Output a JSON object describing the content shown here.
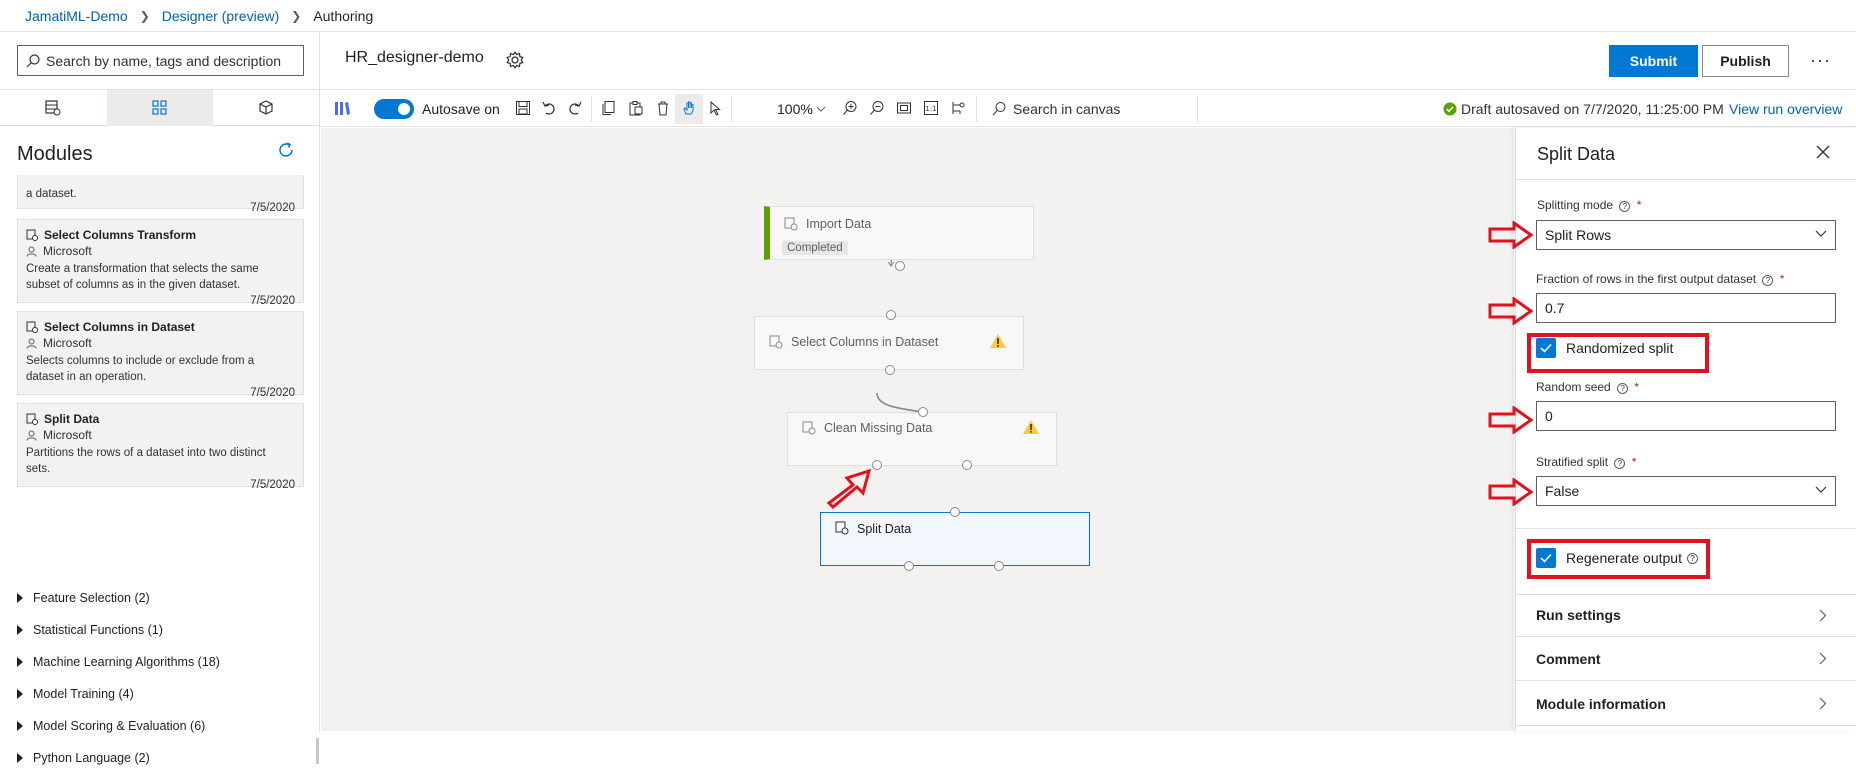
{
  "breadcrumb": {
    "workspace": "JamatiML-Demo",
    "designer": "Designer (preview)",
    "current": "Authoring"
  },
  "search": {
    "placeholder": "Search by name, tags and description"
  },
  "modules": {
    "title": "Modules",
    "cards": [
      {
        "name": "",
        "author": "",
        "desc": "a dataset.",
        "date": "7/5/2020"
      },
      {
        "name": "Select Columns Transform",
        "author": "Microsoft",
        "desc": "Create a transformation that selects the same subset of columns as in the given dataset.",
        "date": "7/5/2020"
      },
      {
        "name": "Select Columns in Dataset",
        "author": "Microsoft",
        "desc": "Selects columns to include or exclude from a dataset in an operation.",
        "date": "7/5/2020"
      },
      {
        "name": "Split Data",
        "author": "Microsoft",
        "desc": "Partitions the rows of a dataset into two distinct sets.",
        "date": "7/5/2020"
      }
    ],
    "categories": [
      "Feature Selection (2)",
      "Statistical Functions (1)",
      "Machine Learning Algorithms (18)",
      "Model Training (4)",
      "Model Scoring & Evaluation (6)",
      "Python Language (2)"
    ]
  },
  "header": {
    "pipeline_name": "HR_designer-demo",
    "submit": "Submit",
    "publish": "Publish",
    "more": "···"
  },
  "toolbar": {
    "autosave": "Autosave on",
    "zoom": "100%",
    "canvas_search": "Search in canvas",
    "draft_status": "Draft autosaved on 7/7/2020, 11:25:00 PM",
    "view_run": "View run overview"
  },
  "canvas": {
    "nodes": [
      {
        "title": "Import Data",
        "status": "Completed"
      },
      {
        "title": "Select Columns in Dataset"
      },
      {
        "title": "Clean Missing Data"
      },
      {
        "title": "Split Data"
      }
    ]
  },
  "panel": {
    "title": "Split Data",
    "splitting_mode_label": "Splitting mode",
    "splitting_mode_value": "Split Rows",
    "fraction_label": "Fraction of rows in the first output dataset",
    "fraction_value": "0.7",
    "randomized_label": "Randomized split",
    "seed_label": "Random seed",
    "seed_value": "0",
    "stratified_label": "Stratified split",
    "stratified_value": "False",
    "regenerate_label": "Regenerate output",
    "run_settings": "Run settings",
    "comment": "Comment",
    "module_info": "Module information",
    "required_mark": "*"
  },
  "colors": {
    "accent": "#0078d4",
    "annotation": "#e3101e",
    "success": "#57a300",
    "warning": "#ffc83d"
  }
}
